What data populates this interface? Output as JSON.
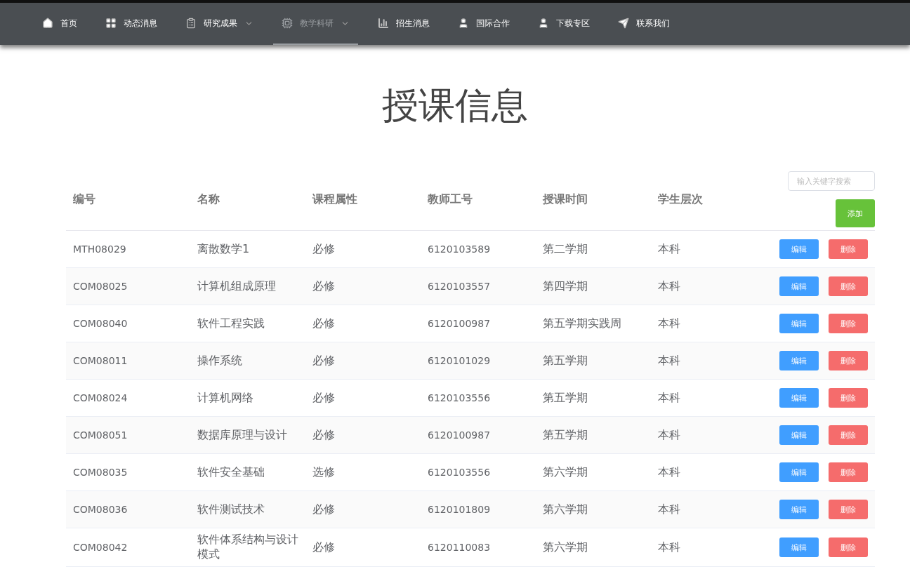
{
  "nav": [
    {
      "label": "首页",
      "dropdown": false,
      "selected": false
    },
    {
      "label": "动态消息",
      "dropdown": false,
      "selected": false
    },
    {
      "label": "研究成果",
      "dropdown": true,
      "selected": false
    },
    {
      "label": "教学科研",
      "dropdown": true,
      "selected": true
    },
    {
      "label": "招生消息",
      "dropdown": false,
      "selected": false
    },
    {
      "label": "国际合作",
      "dropdown": false,
      "selected": false
    },
    {
      "label": "下载专区",
      "dropdown": false,
      "selected": false
    },
    {
      "label": "联系我们",
      "dropdown": false,
      "selected": false
    }
  ],
  "title": "授课信息",
  "table": {
    "columns": [
      "编号",
      "名称",
      "课程属性",
      "教师工号",
      "授课时间",
      "学生层次"
    ],
    "search": {
      "placeholder": "输入关键字搜索"
    },
    "add_button": "添加",
    "rows": [
      {
        "cells": [
          "MTH08029",
          "离散数学1",
          "必修",
          "6120103589",
          "第二学期",
          "本科"
        ],
        "buttons": [
          {
            "label": "编辑",
            "kind": "edit"
          },
          {
            "label": "删除",
            "kind": "delete"
          }
        ]
      },
      {
        "cells": [
          "COM08025",
          "计算机组成原理",
          "必修",
          "6120103557",
          "第四学期",
          "本科"
        ],
        "buttons": [
          {
            "label": "编辑",
            "kind": "edit"
          },
          {
            "label": "删除",
            "kind": "delete"
          }
        ]
      },
      {
        "cells": [
          "COM08040",
          "软件工程实践",
          "必修",
          "6120100987",
          "第五学期实践周",
          "本科"
        ],
        "buttons": [
          {
            "label": "编辑",
            "kind": "edit"
          },
          {
            "label": "删除",
            "kind": "delete"
          }
        ]
      },
      {
        "cells": [
          "COM08011",
          "操作系统",
          "必修",
          "6120101029",
          "第五学期",
          "本科"
        ],
        "buttons": [
          {
            "label": "编辑",
            "kind": "edit"
          },
          {
            "label": "删除",
            "kind": "delete"
          }
        ]
      },
      {
        "cells": [
          "COM08024",
          "计算机网络",
          "必修",
          "6120103556",
          "第五学期",
          "本科"
        ],
        "buttons": [
          {
            "label": "编辑",
            "kind": "edit"
          },
          {
            "label": "删除",
            "kind": "delete"
          }
        ]
      },
      {
        "cells": [
          "COM08051",
          "数据库原理与设计",
          "必修",
          "6120100987",
          "第五学期",
          "本科"
        ],
        "buttons": [
          {
            "label": "编辑",
            "kind": "edit"
          },
          {
            "label": "删除",
            "kind": "delete"
          }
        ]
      },
      {
        "cells": [
          "COM08035",
          "软件安全基础",
          "选修",
          "6120103556",
          "第六学期",
          "本科"
        ],
        "buttons": [
          {
            "label": "编辑",
            "kind": "edit"
          },
          {
            "label": "删除",
            "kind": "delete"
          }
        ]
      },
      {
        "cells": [
          "COM08036",
          "软件测试技术",
          "必修",
          "6120101809",
          "第六学期",
          "本科"
        ],
        "buttons": [
          {
            "label": "编辑",
            "kind": "edit"
          },
          {
            "label": "删除",
            "kind": "delete"
          }
        ]
      },
      {
        "cells": [
          "COM08042",
          "软件体系结构与设计模式",
          "必修",
          "6120110083",
          "第六学期",
          "本科"
        ],
        "buttons": [
          {
            "label": "编辑",
            "kind": "edit"
          },
          {
            "label": "删除",
            "kind": "delete"
          }
        ]
      }
    ]
  }
}
